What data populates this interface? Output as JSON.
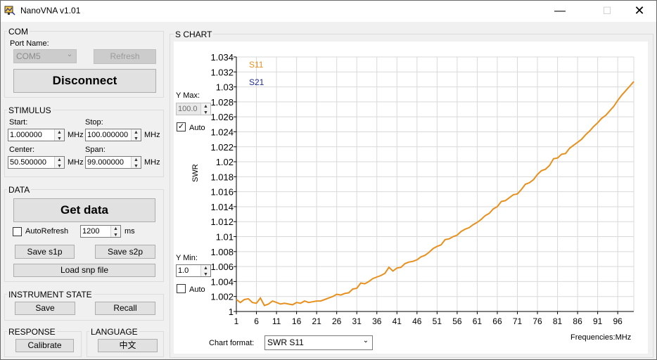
{
  "window": {
    "title": "NanoVNA v1.01",
    "minimize": "—",
    "maximize": "☐",
    "close": "✕"
  },
  "com": {
    "label": "COM",
    "port_name_label": "Port Name:",
    "port_value": "COM5",
    "refresh": "Refresh",
    "disconnect": "Disconnect"
  },
  "stimulus": {
    "label": "STIMULUS",
    "start_label": "Start:",
    "start_value": "1.000000",
    "start_unit": "MHz",
    "stop_label": "Stop:",
    "stop_value": "100.000000",
    "stop_unit": "MHz",
    "center_label": "Center:",
    "center_value": "50.500000",
    "center_unit": "MHz",
    "span_label": "Span:",
    "span_value": "99.000000",
    "span_unit": "MHz"
  },
  "data_group": {
    "label": "DATA",
    "get_data": "Get data",
    "autorefresh_label": "AutoRefresh",
    "autorefresh_checked": false,
    "interval_value": "1200",
    "interval_unit": "ms",
    "save_s1p": "Save s1p",
    "save_s2p": "Save s2p",
    "load_snp": "Load snp file"
  },
  "instrument_state": {
    "label": "INSTRUMENT STATE",
    "save": "Save",
    "recall": "Recall"
  },
  "response": {
    "label": "RESPONSE",
    "calibrate": "Calibrate"
  },
  "language": {
    "label": "LANGUAGE",
    "button": "中文"
  },
  "schart": {
    "label": "S CHART",
    "ymax_label": "Y Max:",
    "ymax_value": "100.0",
    "ymax_auto_label": "Auto",
    "ymax_auto_checked": true,
    "ymin_label": "Y Min:",
    "ymin_value": "1.0",
    "ymin_auto_label": "Auto",
    "ymin_auto_checked": false,
    "y_axis_label": "SWR",
    "freq_label": "Frequencies:MHz",
    "chart_format_label": "Chart format:",
    "chart_format_value": "SWR S11"
  },
  "colors": {
    "s11": "#e8901e",
    "s21": "#1f2e9a",
    "grid": "#d9d9d9"
  },
  "chart_data": {
    "type": "line",
    "xlabel": "",
    "ylabel": "SWR",
    "xlim": [
      1,
      100
    ],
    "ylim": [
      1,
      1.034
    ],
    "x_ticks": [
      1,
      6,
      11,
      16,
      21,
      26,
      31,
      36,
      41,
      46,
      51,
      56,
      61,
      66,
      71,
      76,
      81,
      86,
      91,
      96
    ],
    "y_ticks": [
      1,
      1.002,
      1.004,
      1.006,
      1.008,
      1.01,
      1.012,
      1.014,
      1.016,
      1.018,
      1.02,
      1.022,
      1.024,
      1.026,
      1.028,
      1.03,
      1.032,
      1.034
    ],
    "y_tick_labels": [
      "1",
      "1.002",
      "1.004",
      "1.006",
      "1.008",
      "1.01",
      "1.012",
      "1.014",
      "1.016",
      "1.018",
      "1.02",
      "1.022",
      "1.024",
      "1.026",
      "1.028",
      "1.03",
      "1.032",
      "1.034"
    ],
    "legend": [
      "S11",
      "S21"
    ],
    "series": [
      {
        "name": "S11",
        "x": [
          1,
          2,
          3,
          4,
          5,
          6,
          7,
          8,
          9,
          10,
          11,
          12,
          13,
          14,
          15,
          16,
          17,
          18,
          19,
          20,
          21,
          22,
          23,
          24,
          25,
          26,
          27,
          28,
          29,
          30,
          31,
          32,
          33,
          34,
          35,
          36,
          37,
          38,
          39,
          40,
          41,
          42,
          43,
          44,
          45,
          46,
          47,
          48,
          49,
          50,
          51,
          52,
          53,
          54,
          55,
          56,
          57,
          58,
          59,
          60,
          61,
          62,
          63,
          64,
          65,
          66,
          67,
          68,
          69,
          70,
          71,
          72,
          73,
          74,
          75,
          76,
          77,
          78,
          79,
          80,
          81,
          82,
          83,
          84,
          85,
          86,
          87,
          88,
          89,
          90,
          91,
          92,
          93,
          94,
          95,
          96,
          97,
          98,
          99,
          100
        ],
        "y": [
          1.0016,
          1.0012,
          1.0016,
          1.0017,
          1.0012,
          1.0011,
          1.0018,
          1.0008,
          1.001,
          1.0014,
          1.0012,
          1.001,
          1.0011,
          1.001,
          1.0009,
          1.0012,
          1.0011,
          1.0014,
          1.0012,
          1.0013,
          1.0014,
          1.0014,
          1.0016,
          1.0018,
          1.002,
          1.0023,
          1.0022,
          1.0024,
          1.0025,
          1.003,
          1.0031,
          1.0038,
          1.0037,
          1.004,
          1.0044,
          1.0046,
          1.0048,
          1.0051,
          1.0059,
          1.0054,
          1.0058,
          1.0059,
          1.0064,
          1.0066,
          1.0067,
          1.0069,
          1.0073,
          1.0075,
          1.0079,
          1.0084,
          1.0087,
          1.0089,
          1.0096,
          1.0097,
          1.01,
          1.0102,
          1.0107,
          1.011,
          1.0112,
          1.0116,
          1.0119,
          1.0123,
          1.0128,
          1.0131,
          1.0137,
          1.014,
          1.0147,
          1.0148,
          1.0152,
          1.0156,
          1.0157,
          1.0163,
          1.017,
          1.0172,
          1.0176,
          1.0183,
          1.0188,
          1.019,
          1.0195,
          1.0204,
          1.0205,
          1.021,
          1.0211,
          1.0218,
          1.0222,
          1.0226,
          1.023,
          1.0236,
          1.0241,
          1.0247,
          1.0252,
          1.0258,
          1.0262,
          1.0268,
          1.0274,
          1.0282,
          1.0289,
          1.0295,
          1.0301,
          1.0307
        ]
      }
    ]
  }
}
